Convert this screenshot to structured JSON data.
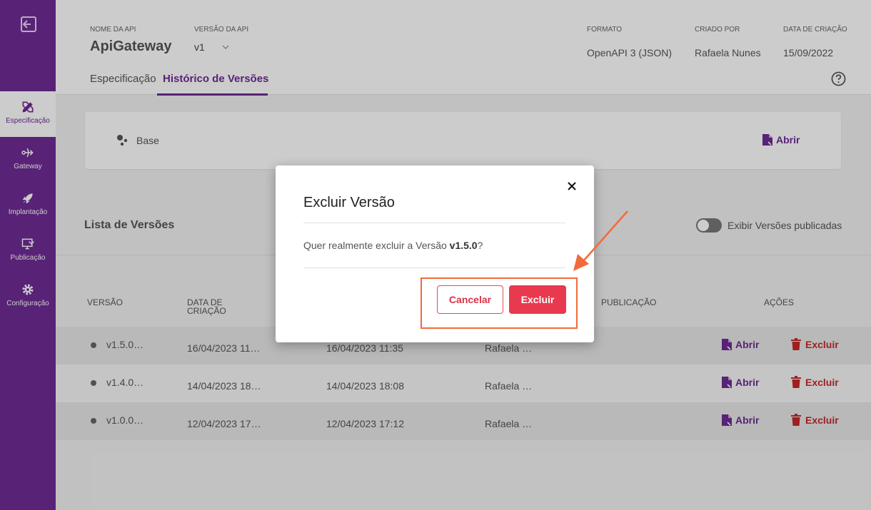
{
  "sidebar": {
    "items": [
      {
        "label": "Especificação",
        "icon": "edit-tools-icon",
        "active": true
      },
      {
        "label": "Gateway",
        "icon": "gateway-icon"
      },
      {
        "label": "Implantação",
        "icon": "rocket-icon"
      },
      {
        "label": "Publicação",
        "icon": "publish-icon"
      },
      {
        "label": "Configuração",
        "icon": "gear-icon"
      }
    ]
  },
  "header": {
    "api_name_label": "NOME DA API",
    "api_name": "ApiGateway",
    "version_label": "VERSÃO DA API",
    "version": "v1",
    "format_label": "FORMATO",
    "format": "OpenAPI 3 (JSON)",
    "created_by_label": "CRIADO POR",
    "created_by": "Rafaela Nunes",
    "created_date_label": "DATA DE CRIAÇÃO",
    "created_date": "15/09/2022",
    "tabs": [
      {
        "label": "Especificação",
        "active": false
      },
      {
        "label": "Histórico de Versões",
        "active": true
      }
    ]
  },
  "base": {
    "label": "Base",
    "open_label": "Abrir"
  },
  "list": {
    "title": "Lista de Versões",
    "toggle_label": "Exibir Versões publicadas",
    "columns": {
      "version": "VERSÃO",
      "created": "DATA DE CRIAÇÃO",
      "publication": "PUBLICAÇÃO",
      "actions": "AÇÕES"
    },
    "open_label": "Abrir",
    "delete_label": "Excluir",
    "rows": [
      {
        "version": "v1.5.0…",
        "created": "16/04/2023 11…",
        "updated": "16/04/2023 11:35",
        "author": "Rafaela …"
      },
      {
        "version": "v1.4.0…",
        "created": "14/04/2023 18…",
        "updated": "14/04/2023 18:08",
        "author": "Rafaela …"
      },
      {
        "version": "v1.0.0…",
        "created": "12/04/2023 17…",
        "updated": "12/04/2023 17:12",
        "author": "Rafaela …"
      }
    ]
  },
  "modal": {
    "title": "Excluir Versão",
    "message_prefix": "Quer realmente excluir a Versão ",
    "message_version": "v1.5.0",
    "message_suffix": "?",
    "cancel_label": "Cancelar",
    "delete_label": "Excluir"
  },
  "colors": {
    "brand": "#6f2b95",
    "danger": "#e8394f",
    "annotation": "#f26b3a"
  }
}
